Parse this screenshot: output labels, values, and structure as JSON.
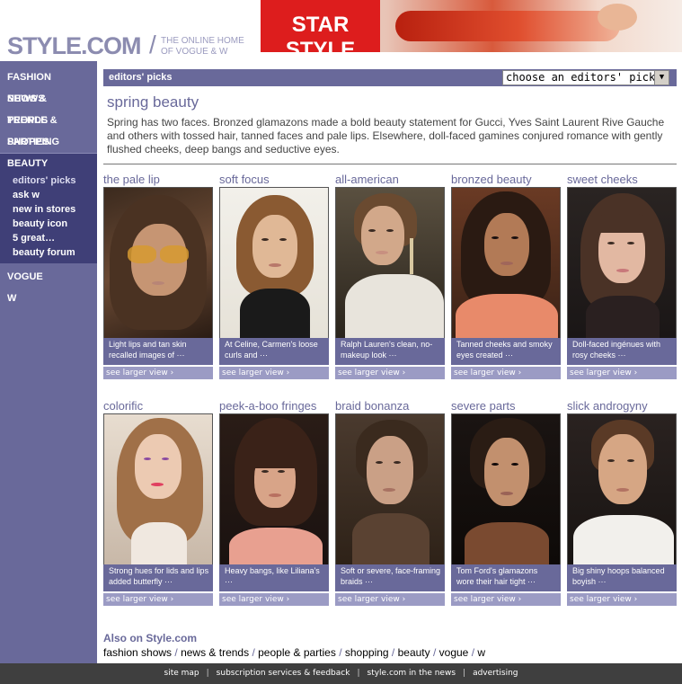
{
  "header": {
    "logo_text": "STYLE.COM",
    "tagline_line1": "THE ONLINE HOME",
    "tagline_line2": "OF VOGUE & W",
    "banner_title": "STAR STYLE"
  },
  "sidebar": {
    "items": [
      {
        "label": "FASHION SHOWS"
      },
      {
        "label": "NEWS & TRENDS"
      },
      {
        "label": "PEOPLE & PARTIES"
      },
      {
        "label": "SHOPPING"
      }
    ],
    "beauty": {
      "label": "BEAUTY",
      "subitems": [
        {
          "label": "editors' picks"
        },
        {
          "label": "ask w"
        },
        {
          "label": "new in stores"
        },
        {
          "label": "beauty icon"
        },
        {
          "label": "5 great…"
        },
        {
          "label": "beauty forum"
        }
      ]
    },
    "vogue_label": "VOGUE",
    "w_label": "W"
  },
  "main": {
    "bar_label": "editors' picks",
    "select_value": "choose an editors' pick",
    "title": "spring beauty",
    "intro": "Spring has two faces. Bronzed glamazons made a bold beauty statement for Gucci, Yves Saint Laurent Rive Gauche and others with tossed hair, tanned faces and pale lips. Elsewhere, doll-faced gamines conjured romance with gently flushed cheeks, deep bangs and seductive eyes.",
    "larger_view_label": "see larger view ›",
    "cards": [
      {
        "title": "the pale lip",
        "caption": "Light lips and tan skin recalled images of ···"
      },
      {
        "title": "soft focus",
        "caption": "At Celine, Carmen's loose curls and ···"
      },
      {
        "title": "all-american",
        "caption": "Ralph Lauren's clean, no-makeup look ···"
      },
      {
        "title": "bronzed beauty",
        "caption": "Tanned cheeks and smoky eyes created ···"
      },
      {
        "title": "sweet cheeks",
        "caption": "Doll-faced ingénues with rosy cheeks ···"
      },
      {
        "title": "colorific",
        "caption": "Strong hues for lids and lips added butterfly ···"
      },
      {
        "title": "peek-a-boo fringes",
        "caption": "Heavy bangs, like Liliana's ···"
      },
      {
        "title": "braid bonanza",
        "caption": "Soft or severe, face-framing braids ···"
      },
      {
        "title": "severe parts",
        "caption": "Tom Ford's glamazons wore their hair tight ···"
      },
      {
        "title": "slick androgyny",
        "caption": "Big shiny hoops balanced boyish ···"
      }
    ]
  },
  "also": {
    "title": "Also on Style.com",
    "links": [
      {
        "label": "fashion shows"
      },
      {
        "label": "news & trends"
      },
      {
        "label": "people & parties"
      },
      {
        "label": "shopping"
      },
      {
        "label": "beauty"
      },
      {
        "label": "vogue"
      },
      {
        "label": "w"
      }
    ]
  },
  "footer": {
    "links": [
      {
        "label": "site map"
      },
      {
        "label": "subscription services & feedback"
      },
      {
        "label": "style.com in the news"
      },
      {
        "label": "advertising"
      }
    ]
  },
  "colors": {
    "brand": "#69699a",
    "brand_dark": "#3f3f77",
    "banner_red": "#dd1d1d"
  }
}
